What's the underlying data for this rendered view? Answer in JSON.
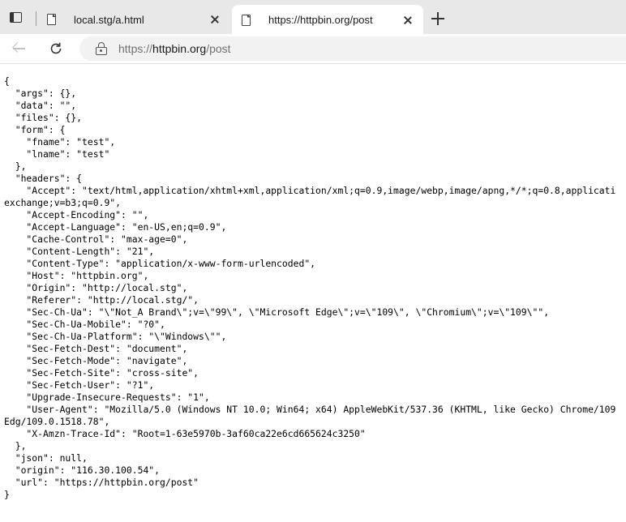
{
  "browser": {
    "tabs": [
      {
        "title": "local.stg/a.html",
        "active": false
      },
      {
        "title": "https://httpbin.org/post",
        "active": true
      }
    ],
    "address_bar": {
      "scheme": "https://",
      "host": "httpbin.org",
      "path": "/post"
    }
  },
  "page": {
    "lines": [
      "{",
      "  \"args\": {},",
      "  \"data\": \"\",",
      "  \"files\": {},",
      "  \"form\": {",
      "    \"fname\": \"test\",",
      "    \"lname\": \"test\"",
      "  },",
      "  \"headers\": {",
      "    \"Accept\": \"text/html,application/xhtml+xml,application/xml;q=0.9,image/webp,image/apng,*/*;q=0.8,applicati",
      "exchange;v=b3;q=0.9\",",
      "    \"Accept-Encoding\": \"\",",
      "    \"Accept-Language\": \"en-US,en;q=0.9\",",
      "    \"Cache-Control\": \"max-age=0\",",
      "    \"Content-Length\": \"21\",",
      "    \"Content-Type\": \"application/x-www-form-urlencoded\",",
      "    \"Host\": \"httpbin.org\",",
      "    \"Origin\": \"http://local.stg\",",
      "    \"Referer\": \"http://local.stg/\",",
      "    \"Sec-Ch-Ua\": \"\\\"Not_A Brand\\\";v=\\\"99\\\", \\\"Microsoft Edge\\\";v=\\\"109\\\", \\\"Chromium\\\";v=\\\"109\\\"\",",
      "    \"Sec-Ch-Ua-Mobile\": \"?0\",",
      "    \"Sec-Ch-Ua-Platform\": \"\\\"Windows\\\"\",",
      "    \"Sec-Fetch-Dest\": \"document\",",
      "    \"Sec-Fetch-Mode\": \"navigate\",",
      "    \"Sec-Fetch-Site\": \"cross-site\",",
      "    \"Sec-Fetch-User\": \"?1\",",
      "    \"Upgrade-Insecure-Requests\": \"1\",",
      "    \"User-Agent\": \"Mozilla/5.0 (Windows NT 10.0; Win64; x64) AppleWebKit/537.36 (KHTML, like Gecko) Chrome/109",
      "Edg/109.0.1518.78\",",
      "    \"X-Amzn-Trace-Id\": \"Root=1-63e5970b-3af60ca22e6cd665624c3250\"",
      "  },",
      "  \"json\": null,",
      "  \"origin\": \"116.30.100.54\",",
      "  \"url\": \"https://httpbin.org/post\"",
      "}"
    ]
  }
}
